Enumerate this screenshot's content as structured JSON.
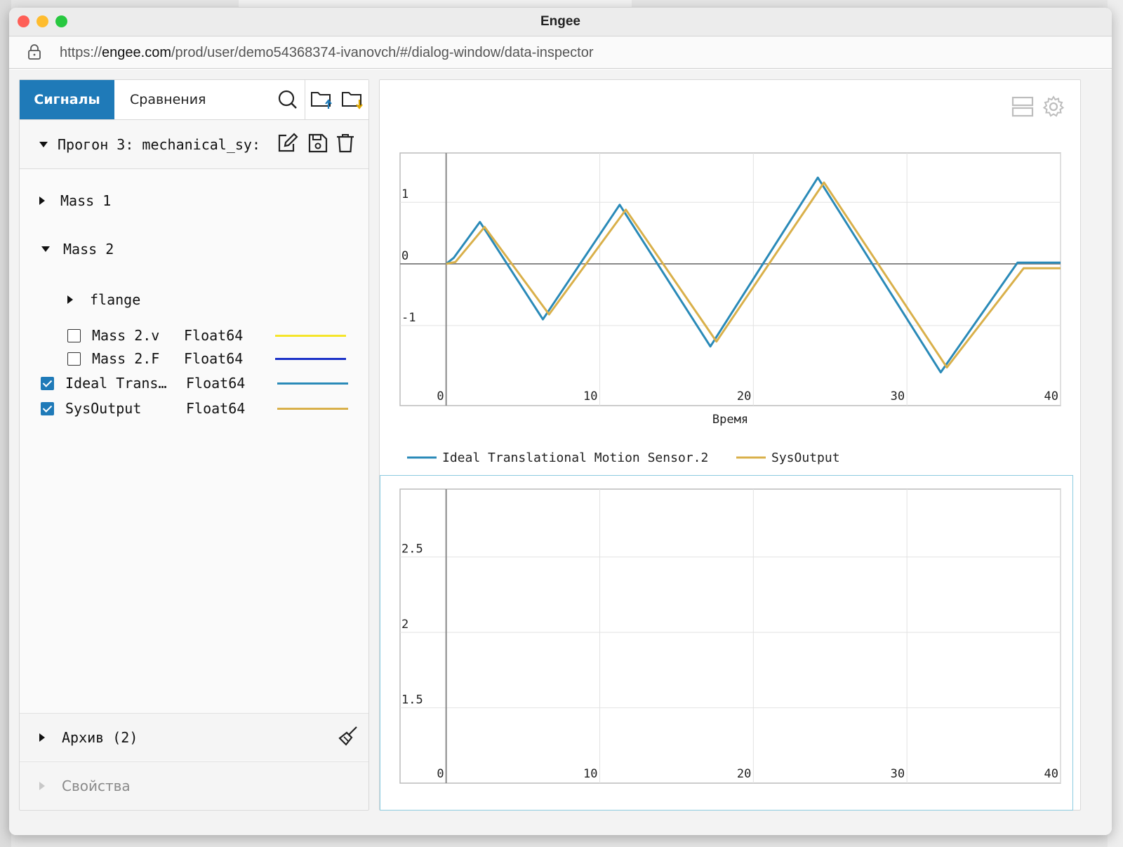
{
  "window": {
    "title": "Engee",
    "url_scheme": "https://",
    "url_host": "engee.com",
    "url_path": "/prod/user/demo54368374-ivanovch/#/dialog-window/data-inspector"
  },
  "tabs": [
    {
      "label": "Сигналы",
      "active": true
    },
    {
      "label": "Сравнения",
      "active": false
    }
  ],
  "run": {
    "label": "Прогон 3: mechanical_sy:"
  },
  "tree": {
    "mass1": "Mass 1",
    "mass2": "Mass 2",
    "flange": "flange",
    "signals": [
      {
        "name": "Mass 2.v",
        "type": "Float64",
        "checked": false,
        "color": "#f5e52a"
      },
      {
        "name": "Mass 2.F",
        "type": "Float64",
        "checked": false,
        "color": "#1a31c8"
      },
      {
        "name": "Ideal Trans…",
        "type": "Float64",
        "checked": true,
        "color": "#2a8ab8"
      },
      {
        "name": "SysOutput",
        "type": "Float64",
        "checked": true,
        "color": "#d9b04a"
      }
    ]
  },
  "archive": {
    "label": "Архив (2)"
  },
  "properties": {
    "label": "Свойства"
  },
  "colors": {
    "accent": "#1f7ab8",
    "series1": "#2a8ab8",
    "series2": "#d9b04a"
  },
  "chart_data": [
    {
      "type": "line",
      "xlabel": "Время",
      "xlim": [
        -3,
        40
      ],
      "ylim": [
        -2.3,
        1.8
      ],
      "x_ticks": [
        0,
        10,
        20,
        30,
        40
      ],
      "y_ticks": [
        1,
        0,
        -1
      ],
      "grid": true,
      "legend_position": "bottom-left",
      "series": [
        {
          "name": "Ideal Translational Motion Sensor.2",
          "x": [
            0,
            0.5,
            2.2,
            6.3,
            11.3,
            17.2,
            24.2,
            32.2,
            37.2,
            40
          ],
          "y": [
            0,
            0.1,
            0.68,
            -0.9,
            0.96,
            -1.34,
            1.4,
            -1.76,
            0.02,
            0.02
          ]
        },
        {
          "name": "SysOutput",
          "x": [
            0,
            0.6,
            2.5,
            6.7,
            11.7,
            17.6,
            24.6,
            32.6,
            37.6,
            40
          ],
          "y": [
            0,
            0.03,
            0.6,
            -0.82,
            0.88,
            -1.26,
            1.32,
            -1.68,
            -0.07,
            -0.07
          ]
        }
      ]
    },
    {
      "type": "line",
      "xlim": [
        -3,
        40
      ],
      "ylim": [
        1.0,
        2.95
      ],
      "x_ticks": [
        0,
        10,
        20,
        30,
        40
      ],
      "y_ticks": [
        2.5,
        2,
        1.5
      ],
      "grid": true,
      "series": []
    }
  ]
}
